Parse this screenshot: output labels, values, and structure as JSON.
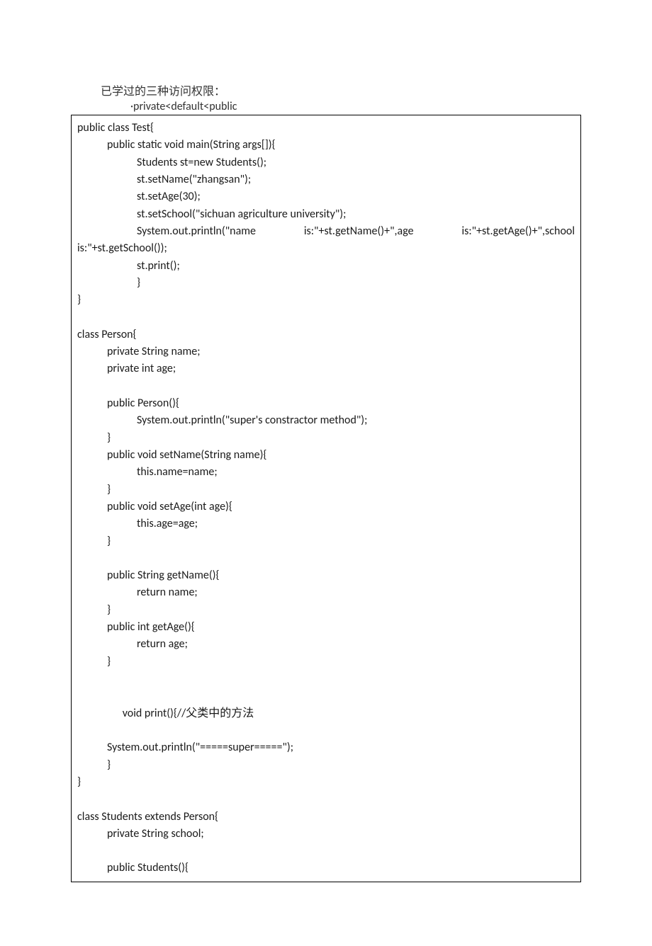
{
  "intro": "已学过的三种访问权限：",
  "bullet": "·private<default<public",
  "code": {
    "l1": "public class Test{",
    "l2": "public static void main(String args[]){",
    "l3": "Students st=new Students();",
    "l4": "st.setName(\"zhangsan\");",
    "l5": "st.setAge(30);",
    "l6": "st.setSchool(\"sichuan agriculture university\");",
    "l7a": "System.out.println(\"name",
    "l7b": "is:\"+st.getName()+\",age",
    "l7c": "is:\"+st.getAge()+\",school",
    "l8": "is:\"+st.getSchool());",
    "l9": "st.print();",
    "l10": "}",
    "l11": "}",
    "l12": "",
    "l13": "class Person{",
    "l14": "private String name;",
    "l15": "private int age;",
    "l16": "",
    "l17": "public Person(){",
    "l18": "System.out.println(\"super's constractor method\");",
    "l19": "}",
    "l20": "public void setName(String name){",
    "l21": "this.name=name;",
    "l22": "}",
    "l23": "public void setAge(int age){",
    "l24": "this.age=age;",
    "l25": "}",
    "l26": "",
    "l27": "public String getName(){",
    "l28": "return name;",
    "l29": "}",
    "l30": "public int getAge(){",
    "l31": "return age;",
    "l32": "}",
    "l33": "",
    "l34a": "void print(){//",
    "l34b": "父类中的方法",
    "l35": "System.out.println(\"=====super=====\");",
    "l36": "}",
    "l37": "}",
    "l38": "",
    "l39": "class Students extends Person{",
    "l40": "private String school;",
    "l41": "",
    "l42": "public Students(){"
  }
}
